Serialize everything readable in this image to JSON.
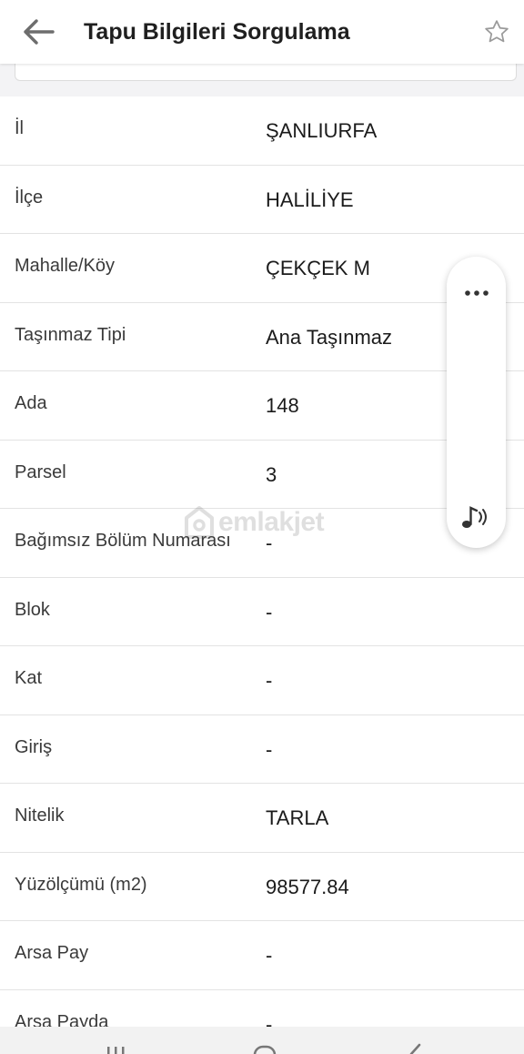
{
  "header": {
    "title": "Tapu Bilgileri Sorgulama"
  },
  "rows": [
    {
      "label": "İl",
      "value": "ŞANLIURFA"
    },
    {
      "label": "İlçe",
      "value": "HALİLİYE"
    },
    {
      "label": "Mahalle/Köy",
      "value": "ÇEKÇEK M"
    },
    {
      "label": "Taşınmaz Tipi",
      "value": "Ana Taşınmaz"
    },
    {
      "label": "Ada",
      "value": "148"
    },
    {
      "label": "Parsel",
      "value": "3"
    },
    {
      "label": "Bağımsız Bölüm Numarası",
      "value": "-"
    },
    {
      "label": "Blok",
      "value": "-"
    },
    {
      "label": "Kat",
      "value": "-"
    },
    {
      "label": "Giriş",
      "value": "-"
    },
    {
      "label": "Nitelik",
      "value": "TARLA"
    },
    {
      "label": "Yüzölçümü (m2)",
      "value": "98577.84"
    },
    {
      "label": "Arsa Pay",
      "value": "-"
    },
    {
      "label": "Arsa Payda",
      "value": "-"
    }
  ],
  "watermark": {
    "text": "emlakjet"
  },
  "icons": {
    "back": "arrow-left-icon",
    "favorite": "star-outline-icon",
    "more": "more-horizontal-icon",
    "audio": "music-note-sound-icon"
  },
  "colors": {
    "background": "#ffffff",
    "divider": "#e3e3e3",
    "band": "#f3f3f5"
  }
}
